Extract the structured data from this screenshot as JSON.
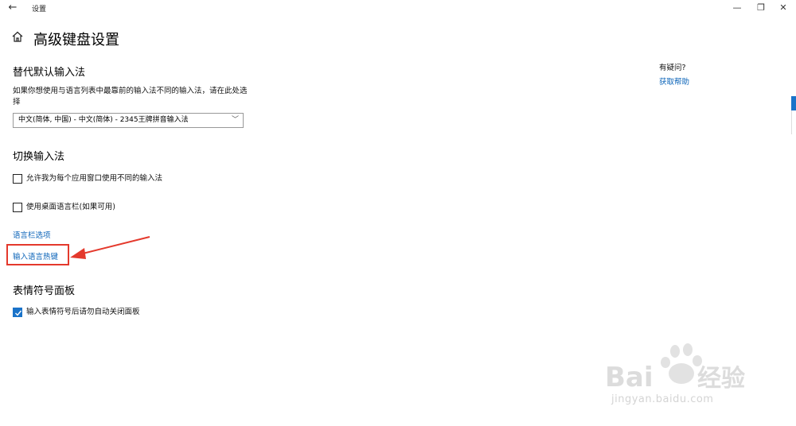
{
  "window": {
    "title": "设置",
    "back_icon": "←",
    "minimize_icon": "—",
    "restore_icon": "❐",
    "close_icon": "✕"
  },
  "page": {
    "title": "高级键盘设置"
  },
  "section_default": {
    "heading": "替代默认输入法",
    "description": "如果你想使用与语言列表中最靠前的输入法不同的输入法，请在此处选择",
    "select_value": "中文(简体, 中国) - 中文(简体) - 2345王牌拼音输入法",
    "select_chevron": "﹀"
  },
  "section_switch": {
    "heading": "切换输入法",
    "option1": {
      "label": "允许我为每个应用窗口使用不同的输入法",
      "checked": false
    },
    "option2": {
      "label": "使用桌面语言栏(如果可用)",
      "checked": false
    },
    "link_langbar": "语言栏选项",
    "link_hotkeys": "输入语言热键"
  },
  "section_emoji": {
    "heading": "表情符号面板",
    "option1": {
      "label": "输入表情符号后请勿自动关闭面板",
      "checked": true
    }
  },
  "help": {
    "question": "有疑问?",
    "link": "获取帮助"
  },
  "watermark": {
    "brand": "Bai du 经验",
    "url": "jingyan.baidu.com"
  },
  "colors": {
    "accent": "#1a73c9",
    "link": "#0a63b8",
    "highlight": "#e4392c"
  }
}
